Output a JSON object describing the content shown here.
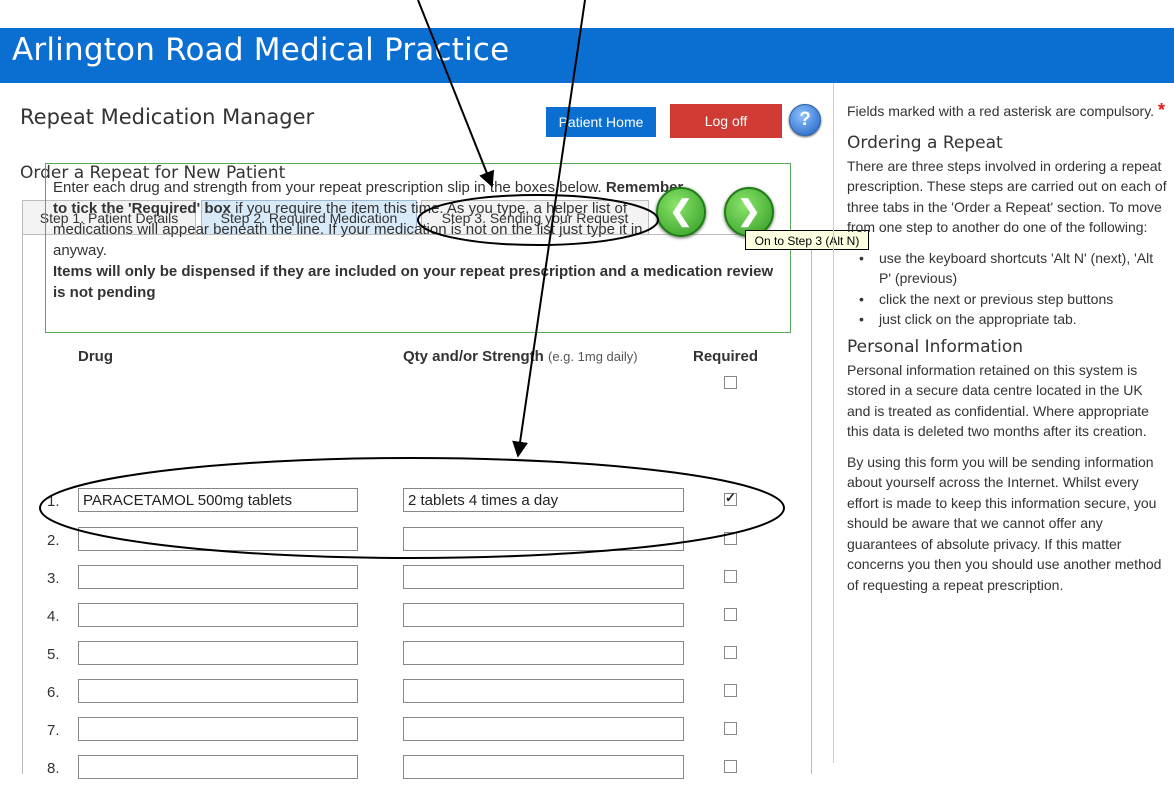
{
  "banner": {
    "title": "Arlington Road Medical Practice"
  },
  "header": {
    "app_title": "Repeat Medication Manager",
    "patient_home_label": "Patient Home",
    "logoff_label": "Log off",
    "help_glyph": "?"
  },
  "section_title": "Order a Repeat for New Patient",
  "tabs": [
    {
      "label": "Step 1. Patient Details"
    },
    {
      "label": "Step 2. Required Medication"
    },
    {
      "label": "Step 3. Sending your Request"
    }
  ],
  "info": {
    "line1": "Enter each drug and strength from your repeat prescription slip in the boxes below.",
    "bold1": "Remember to tick the 'Required' box",
    "line2": " if you require the item this time. As you type, a helper list of medications will appear beneath the line. If your medication is not on the list just type it in anyway.",
    "bold2": "Items will only be dispensed if they are included on your repeat prescription and a medication review is not pending"
  },
  "nav": {
    "prev_glyph": "❮",
    "next_glyph": "❯",
    "next_tooltip": "On to Step 3 (Alt N)"
  },
  "columns": {
    "drug": "Drug",
    "qty": "Qty and/or Strength",
    "qty_hint": "(e.g. 1mg daily)",
    "required": "Required"
  },
  "rows": [
    {
      "num": "1.",
      "drug": "PARACETAMOL 500mg tablets",
      "qty": "2 tablets 4 times a day",
      "required": true
    },
    {
      "num": "2.",
      "drug": "",
      "qty": "",
      "required": false
    },
    {
      "num": "3.",
      "drug": "",
      "qty": "",
      "required": false
    },
    {
      "num": "4.",
      "drug": "",
      "qty": "",
      "required": false
    },
    {
      "num": "5.",
      "drug": "",
      "qty": "",
      "required": false
    },
    {
      "num": "6.",
      "drug": "",
      "qty": "",
      "required": false
    },
    {
      "num": "7.",
      "drug": "",
      "qty": "",
      "required": false
    },
    {
      "num": "8.",
      "drug": "",
      "qty": "",
      "required": false
    }
  ],
  "sidebar": {
    "intro": "Fields marked with a red asterisk are compulsory.",
    "asterisk": "*",
    "ordering_heading": "Ordering a Repeat",
    "ordering_text": "There are three steps involved in ordering a repeat prescription. These steps are carried out on each of three tabs in the 'Order a Repeat' section. To move from one step to another do one of the following:",
    "bullets": [
      "use the keyboard shortcuts 'Alt N' (next), 'Alt P' (previous)",
      "click the next or previous step buttons",
      "just click on the appropriate tab."
    ],
    "personal_heading": "Personal Information",
    "personal_text1": "Personal information retained on this system is stored in a secure data centre located in the UK and is treated as confidential. Where appropriate this data is deleted two months after its creation.",
    "personal_text2": "By using this form you will be sending information about yourself across the Internet. Whilst every effort is made to keep this information secure, you should be aware that we cannot offer any guarantees of absolute privacy. If this matter concerns you then you should use another method of requesting a repeat prescription."
  },
  "colors": {
    "banner": "#0b6fd1",
    "logoff": "#d03c34",
    "info_border": "#5ca95c",
    "asterisk": "#e21b1b"
  }
}
